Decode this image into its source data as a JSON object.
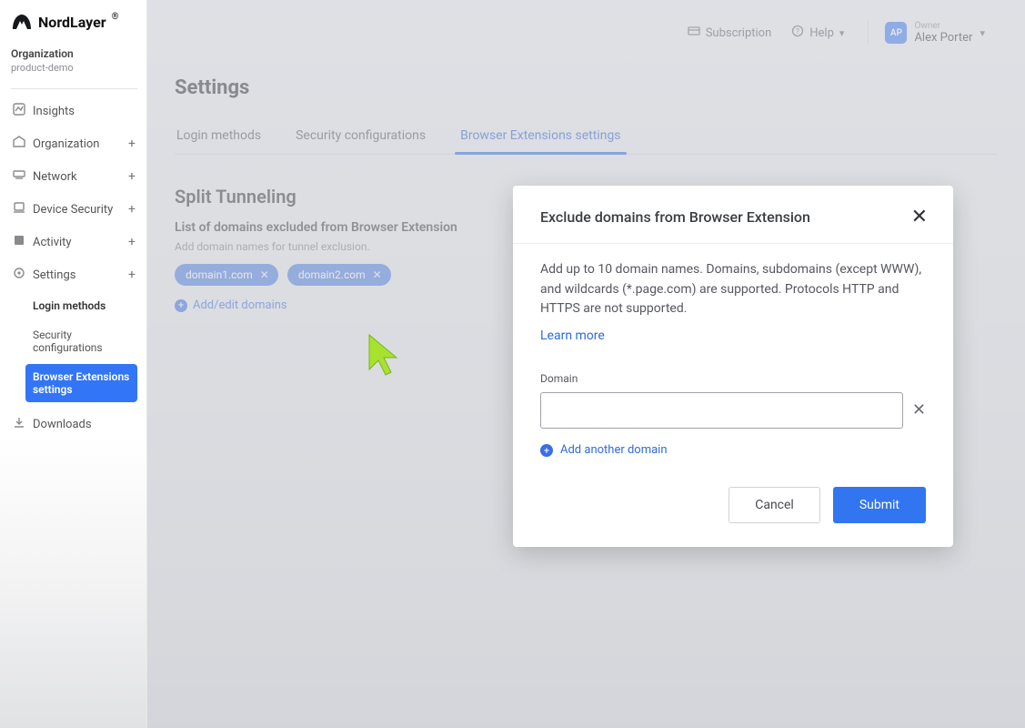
{
  "brand": {
    "name": "NordLayer"
  },
  "org": {
    "label": "Organization",
    "name": "product-demo"
  },
  "sidebar": {
    "items": [
      {
        "label": "Insights",
        "expandable": false
      },
      {
        "label": "Organization",
        "expandable": true
      },
      {
        "label": "Network",
        "expandable": true
      },
      {
        "label": "Device Security",
        "expandable": true
      },
      {
        "label": "Activity",
        "expandable": true
      },
      {
        "label": "Settings",
        "expandable": true
      }
    ],
    "settings_sub": [
      {
        "label": "Login methods"
      },
      {
        "label": "Security configurations"
      },
      {
        "label": "Browser Extensions settings"
      }
    ],
    "downloads": "Downloads"
  },
  "topbar": {
    "subscription": "Subscription",
    "help": "Help",
    "user": {
      "initials": "AP",
      "role": "Owner",
      "name": "Alex Porter"
    }
  },
  "page": {
    "title": "Settings",
    "tabs": [
      {
        "label": "Login methods"
      },
      {
        "label": "Security configurations"
      },
      {
        "label": "Browser Extensions settings"
      }
    ],
    "section_title": "Split Tunneling",
    "list_heading": "List of domains excluded from Browser Extension",
    "list_hint": "Add domain names for tunnel exclusion.",
    "domains": [
      "domain1.com",
      "domain2.com"
    ],
    "add_edit": "Add/edit domains"
  },
  "modal": {
    "title": "Exclude domains from Browser Extension",
    "body": "Add up to 10 domain names. Domains, subdomains (except WWW), and wildcards (*.page.com) are supported. Protocols HTTP and HTTPS are not supported.",
    "learn_more": "Learn more",
    "domain_label": "Domain",
    "domain_value": "",
    "add_another": "Add another domain",
    "cancel": "Cancel",
    "submit": "Submit"
  }
}
